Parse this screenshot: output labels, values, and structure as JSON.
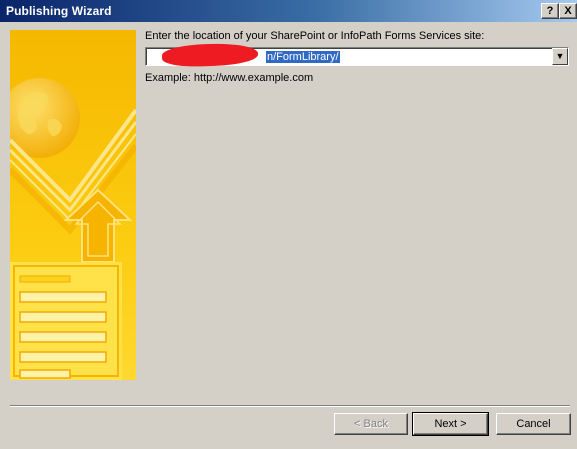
{
  "window": {
    "title": "Publishing Wizard",
    "help_label": "?",
    "close_label": "X"
  },
  "main": {
    "prompt": "Enter the location of your SharePoint or InfoPath Forms Services site:",
    "location_value_visible": "n/FormLibrary/",
    "example": "Example: http://www.example.com"
  },
  "buttons": {
    "back": "< Back",
    "next": "Next >",
    "cancel": "Cancel"
  },
  "colors": {
    "title_bar": "#0a246a",
    "dialog_bg": "#d4d0c8",
    "side_panel": "#f8c400",
    "redaction": "#ee1b22",
    "selection": "#316ac5"
  },
  "icons": [
    "globe-check-icon",
    "upload-arrow-icon",
    "form-illustration",
    "dropdown-arrow-icon"
  ]
}
